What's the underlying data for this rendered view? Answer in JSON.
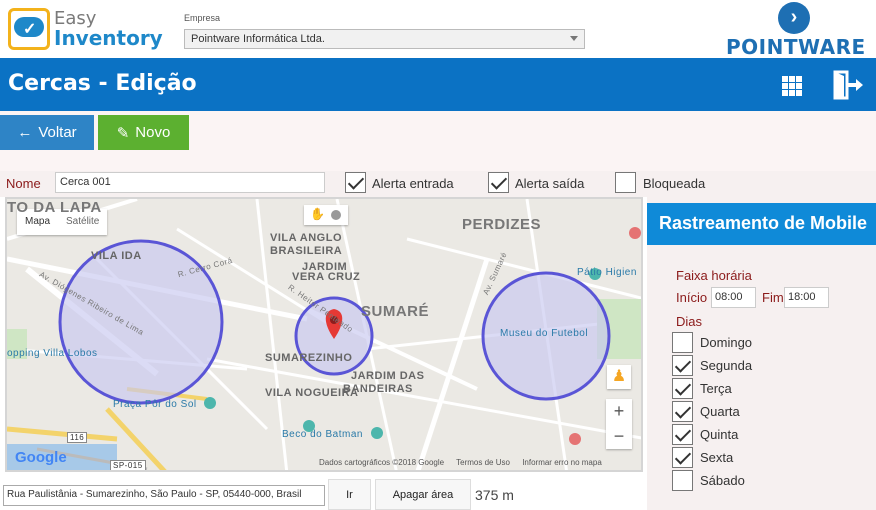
{
  "brand": {
    "logo_line1": "Easy",
    "logo_line2": "Inventory",
    "partner_logo": "POINTWARE"
  },
  "empresa": {
    "label": "Empresa",
    "selected": "Pointware Informática Ltda."
  },
  "header": {
    "title": "Cercas - Edição",
    "apps_icon": "grid-icon",
    "exit_icon": "exit-icon"
  },
  "toolbar": {
    "back_label": "Voltar",
    "new_label": "Novo"
  },
  "form": {
    "nome_label": "Nome",
    "nome_value": "Cerca 001",
    "alerta_entrada_label": "Alerta entrada",
    "alerta_entrada_checked": true,
    "alerta_saida_label": "Alerta saída",
    "alerta_saida_checked": true,
    "bloqueada_label": "Bloqueada",
    "bloqueada_checked": false
  },
  "map": {
    "tab_map": "Mapa",
    "tab_satellite": "Satélite",
    "labels": {
      "lapa": "TO DA LAPA",
      "vila_anglo": "VILA ANGLO",
      "brasileira": "BRASILEIRA",
      "perdizes": "PERDIZES",
      "vila_ida": "VILA IDA",
      "jardim": "JARDIM",
      "vera_cruz": "VERA CRUZ",
      "sumare": "SUMARÉ",
      "sumarezinho": "SUMAREZINHO",
      "vila_nogueira": "VILA NOGUEIRA",
      "jardim_das": "JARDIM DAS",
      "bandeiras": "BANDEIRAS",
      "patio": "Pátio Higien",
      "museu": "Museu do Futebol",
      "shopping": "opping Villa Lobos",
      "praca": "Praça Pôr do Sol",
      "beco": "Beco do Batman",
      "corro": "R. Cerro Corá",
      "heitor": "R. Heitor Penteado",
      "sumare_av": "Av. Sumaré",
      "diogenes": "Av. Diógenes Ribeiro de Lima",
      "route116": "116",
      "routesp": "SP-015"
    },
    "footer_data": "Dados cartográficos ©2018 Google",
    "footer_terms": "Termos de Uso",
    "footer_report": "Informar erro no mapa",
    "google": "Google",
    "zoom_in": "+",
    "zoom_out": "−"
  },
  "address": {
    "value": "Rua Paulistânia - Sumarezinho, São Paulo - SP, 05440-000, Brasil",
    "go_label": "Ir",
    "clear_label": "Apagar área",
    "distance": "375 m"
  },
  "panel": {
    "header": "Rastreamento de Mobile",
    "faixa_label": "Faixa horária",
    "inicio_label": "Início",
    "inicio_value": "08:00",
    "fim_label": "Fim",
    "fim_value": "18:00",
    "dias_label": "Dias",
    "days": [
      {
        "label": "Domingo",
        "checked": false
      },
      {
        "label": "Segunda",
        "checked": true
      },
      {
        "label": "Terça",
        "checked": true
      },
      {
        "label": "Quarta",
        "checked": true
      },
      {
        "label": "Quinta",
        "checked": true
      },
      {
        "label": "Sexta",
        "checked": true
      },
      {
        "label": "Sábado",
        "checked": false
      }
    ]
  },
  "colors": {
    "primary": "#0b72c4",
    "voltar": "#2e84c6",
    "novo": "#5cb030",
    "label_red": "#8b1a1a",
    "fence_fill": "#c8c8f0",
    "fence_stroke": "#5a55d6",
    "marker": "#e53935"
  }
}
